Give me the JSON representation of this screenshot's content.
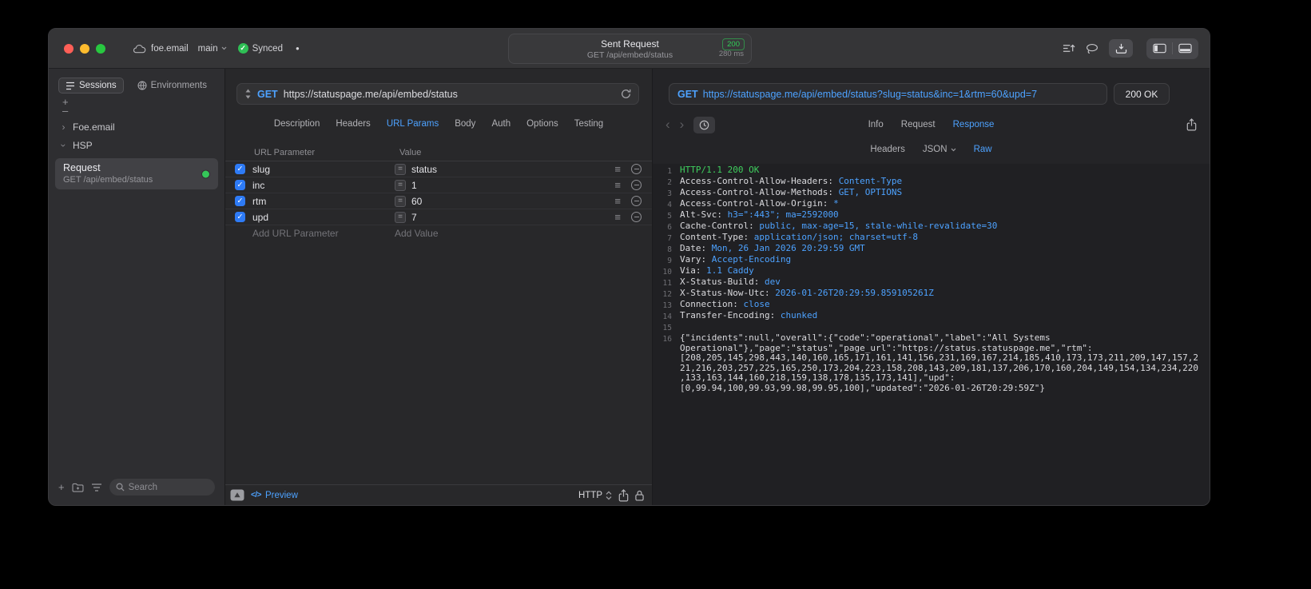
{
  "icons": {
    "check": "✓",
    "equals": "=",
    "hamburger": "≡",
    "plus": "+",
    "minus": "–",
    "back": "‹",
    "forward": "›",
    "chevron_right": "›",
    "code_glyph": "</>",
    "activity_dot": "●"
  },
  "colors": {
    "accent_blue": "#4da2ff",
    "status_green": "#30d158"
  },
  "titlebar": {
    "project": "foe.email",
    "branch": "main",
    "sync": "Synced",
    "request_title": "Sent Request",
    "request_status": "200",
    "request_subtitle": "GET /api/embed/status",
    "request_duration": "280 ms"
  },
  "sidebar": {
    "tabs": [
      "Sessions",
      "Environments"
    ],
    "groups": [
      "Foe.email",
      "HSP"
    ],
    "request_item": {
      "title": "Request",
      "subtitle": "GET /api/embed/status"
    },
    "search_placeholder": "Search"
  },
  "request_panel": {
    "method": "GET",
    "url": "https://statuspage.me/api/embed/status",
    "tabs": [
      "Description",
      "Headers",
      "URL Params",
      "Body",
      "Auth",
      "Options",
      "Testing"
    ],
    "active_tab": "URL Params",
    "table": {
      "columns": [
        "URL Parameter",
        "Value"
      ],
      "rows": [
        {
          "key": "slug",
          "value": "status",
          "enabled": true
        },
        {
          "key": "inc",
          "value": "1",
          "enabled": true
        },
        {
          "key": "rtm",
          "value": "60",
          "enabled": true
        },
        {
          "key": "upd",
          "value": "7",
          "enabled": true
        }
      ],
      "add_key_placeholder": "Add URL Parameter",
      "add_value_placeholder": "Add Value"
    },
    "footer": {
      "preview": "Preview",
      "protocol": "HTTP"
    }
  },
  "response_panel": {
    "method": "GET",
    "url": "https://statuspage.me/api/embed/status?slug=status&inc=1&rtm=60&upd=7",
    "status": "200 OK",
    "tabs": [
      "Info",
      "Request",
      "Response"
    ],
    "active_tab": "Response",
    "subtabs": [
      "Headers",
      "JSON",
      "Raw"
    ],
    "active_subtab": "Raw",
    "lines": [
      {
        "n": "1",
        "seg": [
          [
            "HTTP/1.1 200 OK",
            "g"
          ]
        ]
      },
      {
        "n": "2",
        "seg": [
          [
            "Access-Control-Allow-Headers: ",
            "p"
          ],
          [
            "Content-Type",
            "b"
          ]
        ]
      },
      {
        "n": "3",
        "seg": [
          [
            "Access-Control-Allow-Methods: ",
            "p"
          ],
          [
            "GET, OPTIONS",
            "b"
          ]
        ]
      },
      {
        "n": "4",
        "seg": [
          [
            "Access-Control-Allow-Origin: ",
            "p"
          ],
          [
            "*",
            "b"
          ]
        ]
      },
      {
        "n": "5",
        "seg": [
          [
            "Alt-Svc: ",
            "p"
          ],
          [
            "h3=\":443\"; ma=2592000",
            "b"
          ]
        ]
      },
      {
        "n": "6",
        "seg": [
          [
            "Cache-Control: ",
            "p"
          ],
          [
            "public, max-age=15, stale-while-revalidate=30",
            "b"
          ]
        ]
      },
      {
        "n": "7",
        "seg": [
          [
            "Content-Type: ",
            "p"
          ],
          [
            "application/json; charset=utf-8",
            "b"
          ]
        ]
      },
      {
        "n": "8",
        "seg": [
          [
            "Date: ",
            "p"
          ],
          [
            "Mon, 26 Jan 2026 20:29:59 GMT",
            "b"
          ]
        ]
      },
      {
        "n": "9",
        "seg": [
          [
            "Vary: ",
            "p"
          ],
          [
            "Accept-Encoding",
            "b"
          ]
        ]
      },
      {
        "n": "10",
        "seg": [
          [
            "Via: ",
            "p"
          ],
          [
            "1.1 Caddy",
            "b"
          ]
        ]
      },
      {
        "n": "11",
        "seg": [
          [
            "X-Status-Build: ",
            "p"
          ],
          [
            "dev",
            "b"
          ]
        ]
      },
      {
        "n": "12",
        "seg": [
          [
            "X-Status-Now-Utc: ",
            "p"
          ],
          [
            "2026-01-26T20:29:59.859105261Z",
            "b"
          ]
        ]
      },
      {
        "n": "13",
        "seg": [
          [
            "Connection: ",
            "p"
          ],
          [
            "close",
            "b"
          ]
        ]
      },
      {
        "n": "14",
        "seg": [
          [
            "Transfer-Encoding: ",
            "p"
          ],
          [
            "chunked",
            "b"
          ]
        ]
      },
      {
        "n": "15",
        "seg": []
      },
      {
        "n": "16",
        "seg": [
          [
            "{\"incidents\":null,\"overall\":{\"code\":\"operational\",\"label\":\"All Systems Operational\"},\"page\":\"status\",\"page_url\":\"https://status.statuspage.me\",\"rtm\":[208,205,145,298,443,140,160,165,171,161,141,156,231,169,167,214,185,410,173,173,211,209,147,157,221,216,203,257,225,165,250,173,204,223,158,208,143,209,181,137,206,170,160,204,149,154,134,234,220,133,163,144,160,218,159,138,178,135,173,141],\"upd\":[0,99.94,100,99.93,99.98,99.95,100],\"updated\":\"2026-01-26T20:29:59Z\"}",
            "p"
          ]
        ]
      }
    ]
  }
}
